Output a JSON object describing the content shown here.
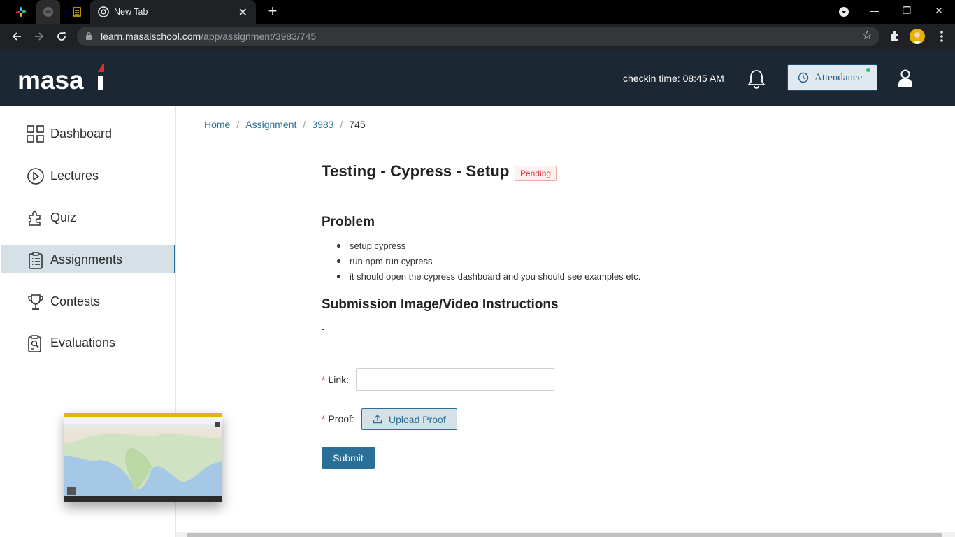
{
  "browser": {
    "tabs": [
      {
        "title": ""
      },
      {
        "title": ""
      },
      {
        "title": ""
      },
      {
        "title": "New Tab"
      }
    ],
    "url_host": "learn.masaischool.com",
    "url_path": "/app/assignment/3983/745"
  },
  "header": {
    "logo_text": "masai",
    "checkin_text": "checkin time: 08:45 AM",
    "attendance_label": "Attendance",
    "accent": "#1c2734"
  },
  "sidebar": {
    "items": [
      {
        "label": "Dashboard",
        "icon": "grid-icon",
        "active": false
      },
      {
        "label": "Lectures",
        "icon": "play-circle-icon",
        "active": false
      },
      {
        "label": "Quiz",
        "icon": "puzzle-icon",
        "active": false
      },
      {
        "label": "Assignments",
        "icon": "clipboard-list-icon",
        "active": true
      },
      {
        "label": "Contests",
        "icon": "trophy-icon",
        "active": false
      },
      {
        "label": "Evaluations",
        "icon": "clipboard-search-icon",
        "active": false
      }
    ]
  },
  "breadcrumb": {
    "items": [
      "Home",
      "Assignment",
      "3983"
    ],
    "current": "745",
    "separator": "/"
  },
  "assignment": {
    "title": "Testing - Cypress - Setup",
    "status": "Pending",
    "problem_heading": "Problem",
    "problem_items": [
      "setup cypress",
      "run npm run cypress",
      "it should open the cypress dashboard and you should see examples etc."
    ],
    "submission_heading": "Submission Image/Video Instructions",
    "submission_text": "-"
  },
  "form": {
    "link_label": "Link",
    "link_value": "",
    "proof_label": "Proof",
    "required_mark": "*",
    "upload_label": "Upload Proof",
    "submit_label": "Submit"
  }
}
